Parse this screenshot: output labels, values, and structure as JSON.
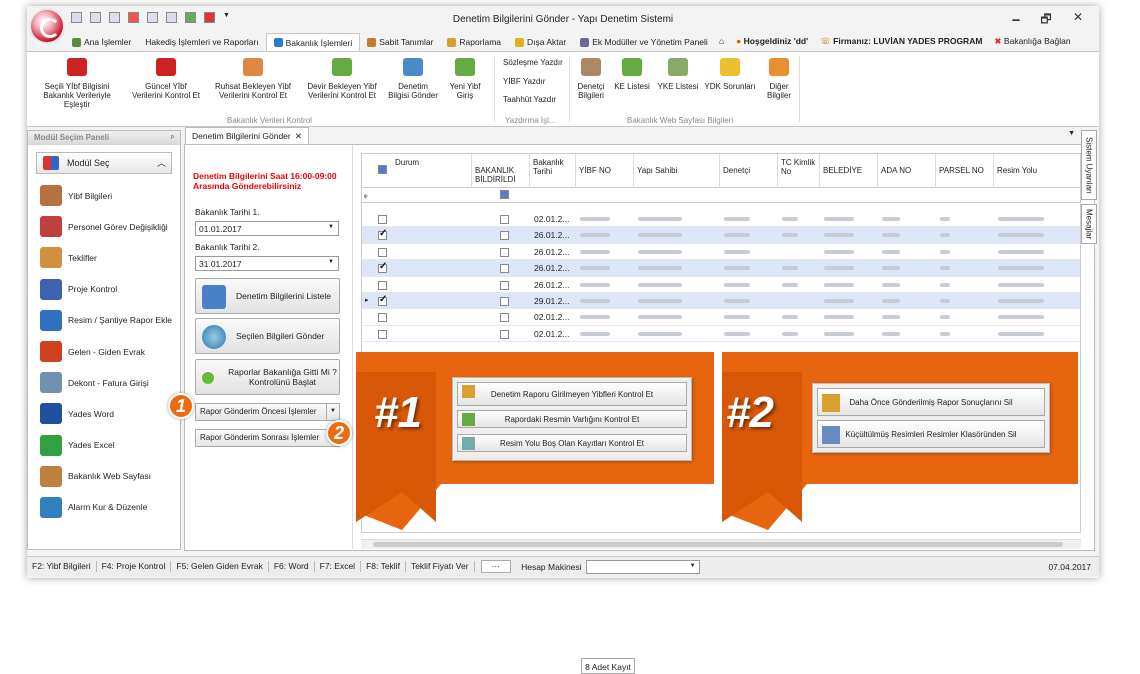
{
  "window": {
    "title": "Denetim Bilgilerini Gönder - Yapı Denetim Sistemi",
    "minimize": "🗕",
    "restore": "🗗",
    "close": "✕"
  },
  "tabs": [
    {
      "label": "Ana İşlemler",
      "color": "#5a8a3a"
    },
    {
      "label": "Hakediş İşlemleri ve Raporları",
      "color": ""
    },
    {
      "label": "Bakanlık İşlemleri",
      "color": "#2b7bd0"
    },
    {
      "label": "Sabit Tanımlar",
      "color": "#c87a2a"
    },
    {
      "label": "Raporlama",
      "color": "#d4a030"
    },
    {
      "label": "Dışa Aktar",
      "color": "#e0b020"
    },
    {
      "label": "Ek Modüller ve Yönetim Paneli",
      "color": "#6a6a9a"
    }
  ],
  "topright": {
    "greet": "Hoşgeldiniz 'dd'",
    "firm": "Firmanız: LUVİAN YADES PROGRAM",
    "connect": "Bakanlığa Bağlan"
  },
  "ribbon": {
    "buttons1": [
      {
        "l1": "Seçili Yİbf Bilgisini",
        "l2": "Bakanlık Verileriyle Eşleştir"
      },
      {
        "l1": "Güncel Yİbf",
        "l2": "Verilerini Kontrol Et"
      },
      {
        "l1": "Ruhsat Bekleyen Yibf",
        "l2": "Verilerini Kontrol Et"
      },
      {
        "l1": "Devir Bekleyen Yibf",
        "l2": "Verilerini Kontrol Et"
      },
      {
        "l1": "Denetim",
        "l2": "Bilgisi Gönder"
      },
      {
        "l1": "Yeni Yibf",
        "l2": "Giriş"
      }
    ],
    "group1": "Bakanlık Verileri Kontrol",
    "print": [
      "Sözleşme Yazdır",
      "YİBF Yazdır",
      "Taahhüt Yazdır"
    ],
    "group2": "Yazdırma İşl...",
    "buttons3": [
      {
        "l1": "Denetçi",
        "l2": "Bilgileri"
      },
      {
        "l1": "KE Listesi",
        "l2": ""
      },
      {
        "l1": "YKE Listesi",
        "l2": ""
      },
      {
        "l1": "YDK Sorunları",
        "l2": ""
      },
      {
        "l1": "Diğer",
        "l2": "Bilgiler"
      }
    ],
    "group3": "Bakanlık Web Sayfası Bilgileri"
  },
  "leftpanel": {
    "title": "Modül Seçim Paneli",
    "pin": "ᵖ",
    "modsel": "Modül Seç",
    "items": [
      {
        "label": "Yibf Bilgileri",
        "color": "#b87040"
      },
      {
        "label": "Personel Görev Değişikliği",
        "color": "#c04040"
      },
      {
        "label": "Teklifler",
        "color": "#d09040"
      },
      {
        "label": "Proje Kontrol",
        "color": "#4060b0"
      },
      {
        "label": "Resim / Şantiye Rapor Ekle",
        "color": "#3070c0"
      },
      {
        "label": "Gelen - Giden Evrak",
        "color": "#d04020"
      },
      {
        "label": "Dekont - Fatura Girişi",
        "color": "#7090b0"
      },
      {
        "label": "Yades Word",
        "color": "#2050a0"
      },
      {
        "label": "Yades Excel",
        "color": "#30a040"
      },
      {
        "label": "Bakanlık Web Sayfası",
        "color": "#c08040"
      },
      {
        "label": "Alarm Kur & Düzenle",
        "color": "#3080c0"
      }
    ]
  },
  "doctab": {
    "label": "Denetim Bilgilerini Gönder",
    "close": "✕"
  },
  "form": {
    "warning": "Denetim Bilgilerini Saat 16:00-09:00 Arasında Gönderebilirsiniz",
    "date1_label": "Bakanlık Tarihi 1.",
    "date1": "01.01.2017",
    "date2_label": "Bakanlık Tarihi 2.",
    "date2": "31.01.2017",
    "btn_list": "Denetim Bilgilerini Listele",
    "btn_send": "Seçilen Bilgileri Gönder",
    "btn_check": "Raporlar Bakanlığa Gitti Mi ? Kontrolünü Başlat",
    "dd1": "Rapor Gönderim Öncesi İşlemler",
    "dd2": "Rapor Gönderim Sonrası İşlemler"
  },
  "grid": {
    "columns": [
      "Durum",
      "BAKANLIK BİLDİRİLDİ",
      "Bakanlık Tarihi",
      "YİBF NO",
      "Yapı Sahibi",
      "Denetçi",
      "TC Kimlik No",
      "BELEDİYE",
      "ADA NO",
      "PARSEL NO",
      "Resim Yolu"
    ],
    "rows": [
      {
        "checked": false,
        "date": "02.01.2...",
        "sel": false
      },
      {
        "checked": true,
        "date": "26.01.2...",
        "sel": true
      },
      {
        "checked": false,
        "date": "26.01.2...",
        "sel": false
      },
      {
        "checked": true,
        "date": "26.01.2...",
        "sel": true
      },
      {
        "checked": false,
        "date": "26.01.2...",
        "sel": false
      },
      {
        "checked": true,
        "date": "29.01.2...",
        "sel": true
      },
      {
        "checked": false,
        "date": "02.01.2...",
        "sel": false
      },
      {
        "checked": false,
        "date": "02.01.2...",
        "sel": false
      }
    ],
    "footer": "8 Adet Kayıt"
  },
  "overlay1": {
    "buttons": [
      "Denetim Raporu Girilmeyen Yibfleri Kontrol Et",
      "Rapordaki Resmin Varlığını Kontrol Et",
      "Resim Yolu Boş Olan Kayıtları Kontrol Et"
    ],
    "label": "#1"
  },
  "overlay2": {
    "buttons": [
      "Daha Önce Gönderilmiş Rapor Sonuçlarını Sil",
      "Küçültülmüş Resimleri Resimler Klasöründen Sil"
    ],
    "label": "#2"
  },
  "markers": {
    "m1": "1",
    "m2": "2"
  },
  "righttabs": [
    "Sistem Uyarıları",
    "Mesajlar"
  ],
  "status": [
    "F2: Yibf Bilgileri",
    "F4: Proje Kontrol",
    "F5: Gelen Giden Evrak",
    "F6: Word",
    "F7: Excel",
    "F8: Teklif",
    "Teklif Fiyatı Ver"
  ],
  "status_calc": "Hesap Makinesi",
  "status_more": "···",
  "status_date": "07.04.2017",
  "accent": "#e8650f"
}
